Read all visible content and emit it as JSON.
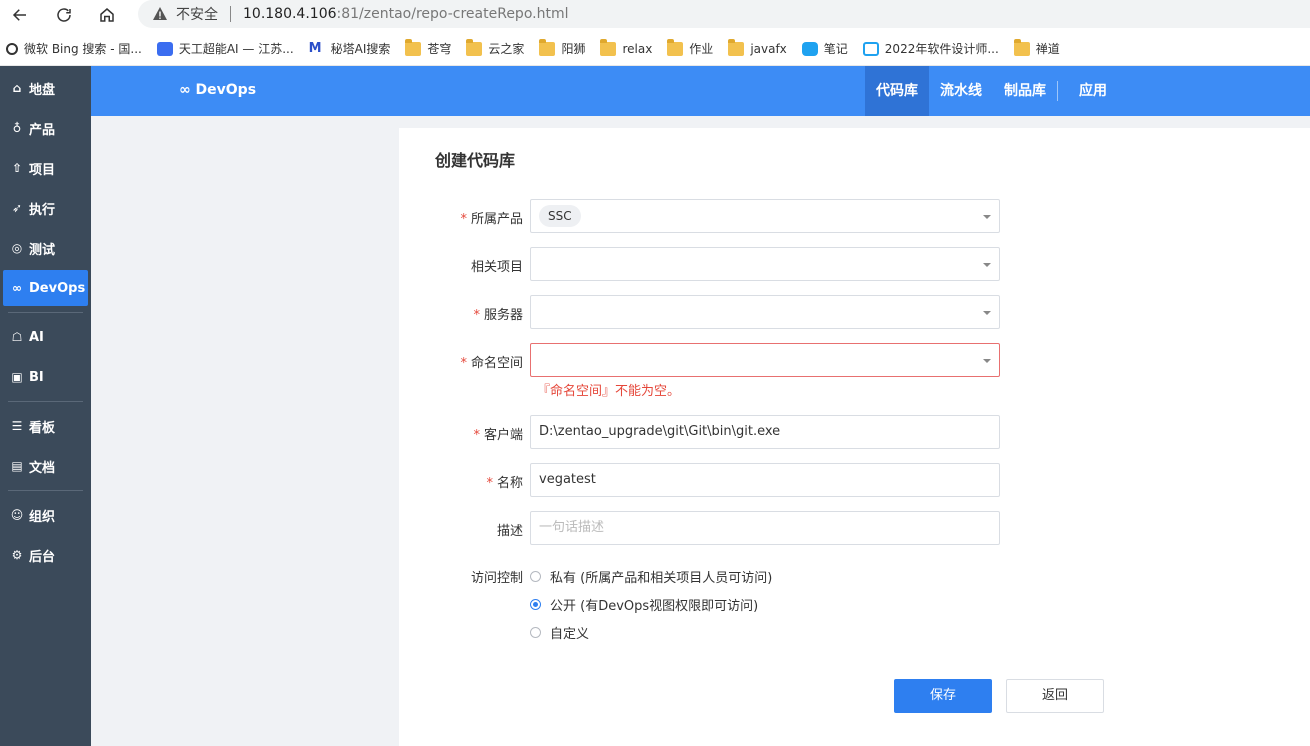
{
  "browser": {
    "insecure_label": "不安全",
    "url_host": "10.180.4.106",
    "url_rest": ":81/zentao/repo-createRepo.html"
  },
  "bookmarks": [
    {
      "label": "微软 Bing 搜索 - 国...",
      "icon": "search-icon"
    },
    {
      "label": "天工超能AI — 江苏...",
      "icon": "tiangong-icon"
    },
    {
      "label": "秘塔AI搜索",
      "icon": "metaso-icon"
    },
    {
      "label": "苍穹",
      "icon": "folder-icon"
    },
    {
      "label": "云之家",
      "icon": "folder-icon"
    },
    {
      "label": "阳狮",
      "icon": "folder-icon"
    },
    {
      "label": "relax",
      "icon": "folder-icon"
    },
    {
      "label": "作业",
      "icon": "folder-icon"
    },
    {
      "label": "javafx",
      "icon": "folder-icon"
    },
    {
      "label": "笔记",
      "icon": "cloud-icon"
    },
    {
      "label": "2022年软件设计师...",
      "icon": "bilibili-icon"
    },
    {
      "label": "禅道",
      "icon": "folder-icon"
    }
  ],
  "sidebar": {
    "items": [
      {
        "label": "地盘",
        "icon": "home-icon"
      },
      {
        "label": "产品",
        "icon": "bulb-icon"
      },
      {
        "label": "项目",
        "icon": "rocket-icon"
      },
      {
        "label": "执行",
        "icon": "run-icon"
      },
      {
        "label": "测试",
        "icon": "bug-search-icon"
      },
      {
        "label": "DevOps",
        "icon": "infinity-icon"
      },
      {
        "label": "AI",
        "icon": "robot-icon"
      },
      {
        "label": "BI",
        "icon": "chart-icon"
      },
      {
        "label": "看板",
        "icon": "board-icon"
      },
      {
        "label": "文档",
        "icon": "doc-icon"
      },
      {
        "label": "组织",
        "icon": "users-icon"
      },
      {
        "label": "后台",
        "icon": "settings-icon"
      }
    ]
  },
  "topbar": {
    "brand": "∞ DevOps",
    "tabs": [
      "代码库",
      "流水线",
      "制品库",
      "应用"
    ]
  },
  "form": {
    "title": "创建代码库",
    "product_label": "所属产品",
    "product_value": "SSC",
    "project_label": "相关项目",
    "server_label": "服务器",
    "namespace_label": "命名空间",
    "namespace_error": "『命名空间』不能为空。",
    "client_label": "客户端",
    "client_value": "D:\\zentao_upgrade\\git\\Git\\bin\\git.exe",
    "name_label": "名称",
    "name_value": "vegatest",
    "desc_label": "描述",
    "desc_placeholder": "一句话描述",
    "access_label": "访问控制",
    "access_options": [
      "私有 (所属产品和相关项目人员可访问)",
      "公开 (有DevOps视图权限即可访问)",
      "自定义"
    ],
    "access_selected": "公开 (有DevOps视图权限即可访问)",
    "save_label": "保存",
    "back_label": "返回"
  },
  "colors": {
    "accent": "#2e7ff0",
    "topbar": "#3d8cf5",
    "sidebar": "#3b4a5a",
    "required": "#e5473a"
  }
}
